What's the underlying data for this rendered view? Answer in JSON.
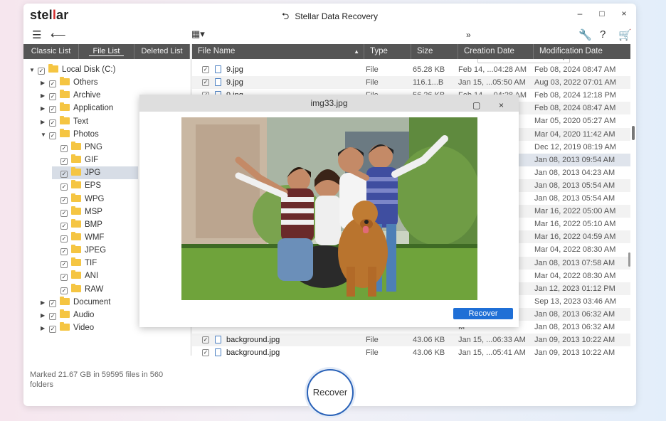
{
  "app": {
    "logo_pre": "stel",
    "logo_mid": "l",
    "logo_post": "ar",
    "title": "Stellar Data Recovery"
  },
  "window_controls": {
    "minimize": "–",
    "maximize": "□",
    "close": "×"
  },
  "toolbar": {
    "menu_icon": "hamburger-icon",
    "back_icon": "back-arrow-icon",
    "view_icon": "grid-view-icon",
    "search_placeholder": "Search"
  },
  "left_tabs": [
    "Classic List",
    "File List",
    "Deleted List"
  ],
  "tree": [
    {
      "label": "Local Disk (C:)",
      "level": 0,
      "expanded": true
    },
    {
      "label": "Others",
      "level": 1,
      "expanded": false
    },
    {
      "label": "Archive",
      "level": 1,
      "expanded": false
    },
    {
      "label": "Application",
      "level": 1,
      "expanded": false
    },
    {
      "label": "Text",
      "level": 1,
      "expanded": false
    },
    {
      "label": "Photos",
      "level": 1,
      "expanded": true
    },
    {
      "label": "PNG",
      "level": 2
    },
    {
      "label": "GIF",
      "level": 2
    },
    {
      "label": "JPG",
      "level": 2,
      "selected": true
    },
    {
      "label": "EPS",
      "level": 2
    },
    {
      "label": "WPG",
      "level": 2
    },
    {
      "label": "MSP",
      "level": 2
    },
    {
      "label": "BMP",
      "level": 2
    },
    {
      "label": "WMF",
      "level": 2
    },
    {
      "label": "JPEG",
      "level": 2
    },
    {
      "label": "TIF",
      "level": 2
    },
    {
      "label": "ANI",
      "level": 2
    },
    {
      "label": "RAW",
      "level": 2
    },
    {
      "label": "Document",
      "level": 1,
      "expanded": false
    },
    {
      "label": "Audio",
      "level": 1,
      "expanded": false
    },
    {
      "label": "Video",
      "level": 1,
      "expanded": false
    }
  ],
  "table": {
    "columns": [
      "File Name",
      "Type",
      "Size",
      "Creation Date",
      "Modification Date"
    ],
    "rows": [
      {
        "name": "9.jpg",
        "type": "File",
        "size": "65.28 KB",
        "created": "Feb 14, ...04:28 AM",
        "modified": "Feb 08, 2024 08:47 AM"
      },
      {
        "name": "9.jpg",
        "type": "File",
        "size": "116.1...B",
        "created": "Jan 15, ...05:50 AM",
        "modified": "Aug 03, 2022 07:01 AM"
      },
      {
        "name": "9.jpg",
        "type": "File",
        "size": "56.26 KB",
        "created": "Feb 14, ...04:28 AM",
        "modified": "Feb 08, 2024 12:18 PM"
      },
      {
        "name": "",
        "type": "",
        "size": "",
        "created": "M",
        "modified": "Feb 08, 2024 08:47 AM"
      },
      {
        "name": "",
        "type": "",
        "size": "",
        "created": "M",
        "modified": "Mar 05, 2020 05:27 AM"
      },
      {
        "name": "",
        "type": "",
        "size": "",
        "created": "M",
        "modified": "Mar 04, 2020 11:42 AM"
      },
      {
        "name": "",
        "type": "",
        "size": "",
        "created": "M",
        "modified": "Dec 12, 2019 08:19 AM"
      },
      {
        "name": "",
        "type": "",
        "size": "",
        "created": "M",
        "modified": "Jan 08, 2013 09:54 AM",
        "selected": true
      },
      {
        "name": "",
        "type": "",
        "size": "",
        "created": "M",
        "modified": "Jan 08, 2013 04:23 AM"
      },
      {
        "name": "",
        "type": "",
        "size": "",
        "created": "M",
        "modified": "Jan 08, 2013 05:54 AM"
      },
      {
        "name": "",
        "type": "",
        "size": "",
        "created": "M",
        "modified": "Jan 08, 2013 05:54 AM"
      },
      {
        "name": "",
        "type": "",
        "size": "",
        "created": "M",
        "modified": "Mar 16, 2022 05:00 AM"
      },
      {
        "name": "",
        "type": "",
        "size": "",
        "created": "M",
        "modified": "Mar 16, 2022 05:10 AM"
      },
      {
        "name": "",
        "type": "",
        "size": "",
        "created": "M",
        "modified": "Mar 16, 2022 04:59 AM"
      },
      {
        "name": "",
        "type": "",
        "size": "",
        "created": "M",
        "modified": "Mar 04, 2022 08:30 AM"
      },
      {
        "name": "",
        "type": "",
        "size": "",
        "created": "M",
        "modified": "Jan 08, 2013 07:58 AM"
      },
      {
        "name": "",
        "type": "",
        "size": "",
        "created": "M",
        "modified": "Mar 04, 2022 08:30 AM"
      },
      {
        "name": "",
        "type": "",
        "size": "",
        "created": "M",
        "modified": "Jan 12, 2023 01:12 PM"
      },
      {
        "name": "",
        "type": "",
        "size": "",
        "created": "M",
        "modified": "Sep 13, 2023 03:46 AM"
      },
      {
        "name": "",
        "type": "",
        "size": "",
        "created": "M",
        "modified": "Jan 08, 2013 06:32 AM"
      },
      {
        "name": "",
        "type": "",
        "size": "",
        "created": "M",
        "modified": "Jan 08, 2013 06:32 AM"
      },
      {
        "name": "background.jpg",
        "type": "File",
        "size": "43.06 KB",
        "created": "Jan 15, ...06:33 AM",
        "modified": "Jan 09, 2013 10:22 AM"
      },
      {
        "name": "background.jpg",
        "type": "File",
        "size": "43.06 KB",
        "created": "Jan 15, ...05:41 AM",
        "modified": "Jan 09, 2013 10:22 AM"
      }
    ]
  },
  "status": {
    "text": "Marked 21.67 GB in 59595 files in 560 folders"
  },
  "recover_button": "Recover",
  "preview": {
    "title": "img33.jpg",
    "recover_label": "Recover",
    "image_icon": "family-with-dog-photo"
  },
  "colors": {
    "accent": "#1f6fd6",
    "header": "#555555",
    "folder": "#f5c542",
    "logo_red": "#d42b2b"
  }
}
